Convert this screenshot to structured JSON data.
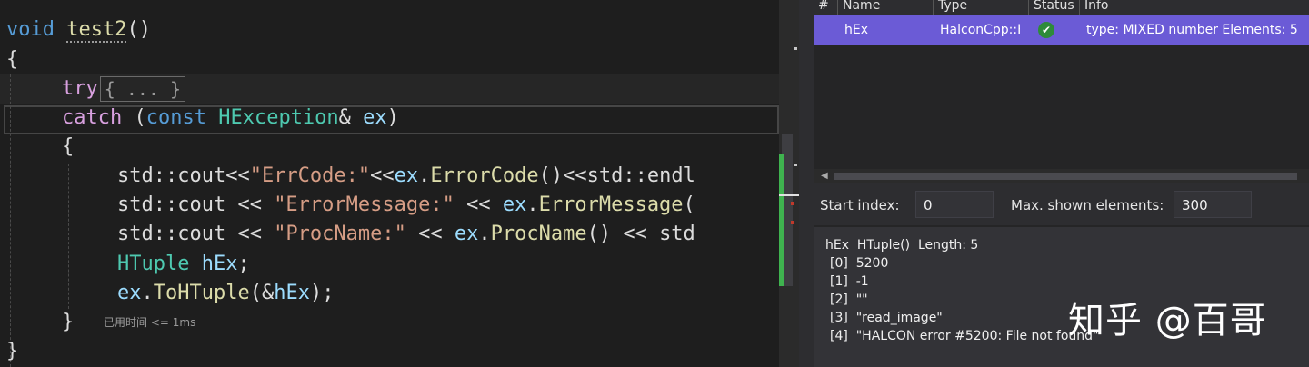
{
  "editor": {
    "func_keyword": "void",
    "func_name": "test2",
    "func_parens": "()",
    "open_brace": "{",
    "try_keyword": "try",
    "try_collapsed": "{ ... }",
    "catch_keyword": "catch",
    "catch_paren_open": "(",
    "catch_const": "const",
    "catch_type": "HException",
    "catch_amp": "&",
    "catch_var": "ex",
    "catch_paren_close": ")",
    "inner_open": "{",
    "l1": {
      "a": "std::cout<<",
      "b": "\"ErrCode:\"",
      "c": "<<",
      "d": "ex",
      "e": ".",
      "f": "ErrorCode",
      "g": "()<<std::endl"
    },
    "l2": {
      "a": "std::cout << ",
      "b": "\"ErrorMessage:\"",
      "c": " << ",
      "d": "ex",
      "e": ".",
      "f": "ErrorMessage",
      "g": "("
    },
    "l3": {
      "a": "std::cout << ",
      "b": "\"ProcName:\"",
      "c": " << ",
      "d": "ex",
      "e": ".",
      "f": "ProcName",
      "g": "() << std"
    },
    "l4": {
      "a": "HTuple",
      "b": " ",
      "c": "hEx",
      "d": ";"
    },
    "l5": {
      "a": "ex",
      "b": ".",
      "c": "ToHTuple",
      "d": "(&",
      "e": "hEx",
      "f": ");"
    },
    "inner_close": "}",
    "elapsed_hint": "已用时间 <= 1ms",
    "close_brace": "}"
  },
  "watch": {
    "headers": {
      "num": "#",
      "name": "Name",
      "type": "Type",
      "status": "Status",
      "info": "Info"
    },
    "row": {
      "name": "hEx",
      "type": "HalconCpp::H",
      "status_icon": "check-circle-icon",
      "info": "type: MIXED number Elements: 5"
    },
    "start_index_label": "Start index:",
    "start_index_value": "0",
    "max_elements_label": "Max. shown elements:",
    "max_elements_value": "300",
    "details": {
      "header": "hEx  HTuple()  Length: 5",
      "items": [
        "[0]  5200",
        "[1]  -1",
        "[2]  \"\"",
        "[3]  \"read_image\"",
        "[4]  \"HALCON error #5200: File not found\""
      ]
    }
  },
  "watermark": "知乎 @百哥",
  "colors": {
    "selection": "#6b5bd6",
    "ok_green": "#2e8b3a",
    "scroll_green": "#3fb34f"
  }
}
